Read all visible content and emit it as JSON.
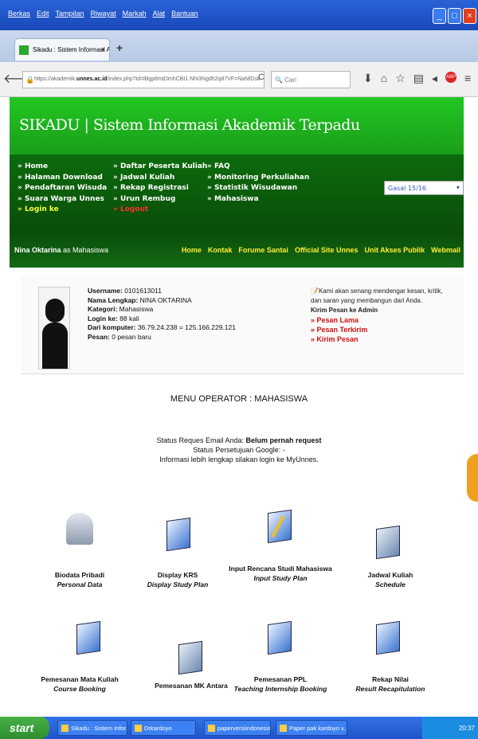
{
  "window": {
    "menu": [
      "Berkas",
      "Edit",
      "Tampilan",
      "Riwayat",
      "Markah",
      "Alat",
      "Bantuan"
    ]
  },
  "tab": {
    "title": "Sikadu : Sistem Informasi Aka...",
    "close": "×",
    "new": "+"
  },
  "address": {
    "url_prefix": "https://akademik.",
    "url_domain": "unnes.ac.id",
    "url_rest": "/index.php?id=lBgp8mtDmhCBt1.NhI3Ngdh2q87VF=NaNfGsk",
    "search_placeholder": "Cari"
  },
  "site": {
    "title": "SIKADU | Sistem Informasi Akademik Terpadu"
  },
  "nav": {
    "col1": [
      "» Home",
      "» Halaman Download",
      "» Pendaftaran Wisuda",
      "» Suara Warga Unnes",
      "» Login ke"
    ],
    "col2": [
      "» Daftar Peserta Kuliah",
      "» Jadwal Kuliah",
      "» Rekap Registrasi",
      "» Urun Rembug",
      "» Logout"
    ],
    "col3": [
      "» FAQ",
      "» Monitoring Perkuliahan",
      "» Statistik Wisudawan",
      "» Mahasiswa"
    ],
    "semester": "Gasal 15/16"
  },
  "userbar": {
    "name": "Nina Oktarina",
    "role": " as Mahasiswa",
    "links": [
      "Home",
      "Kontak",
      "Forume Santai",
      "Official Site Unnes",
      "Unit Akses Publik",
      "Webmail"
    ]
  },
  "profile": {
    "rows": [
      {
        "k": "Username:",
        "v": " 0101613011"
      },
      {
        "k": "Nama Lengkap:",
        "v": " NINA OKTARINA"
      },
      {
        "k": "Kategori:",
        "v": " Mahasiswa"
      },
      {
        "k": "Login ke:",
        "v": " 88 kali"
      },
      {
        "k": "Dari komputer:",
        "v": " 36.79.24.238 = 125.166.229.121"
      },
      {
        "k": "Pesan:",
        "v": " 0 pesan baru"
      }
    ],
    "message_intro": "Kami akan senang mendengar kesan, kritik, dan saran yang membangun dari Anda.",
    "message_head": "Kirim Pesan ke Admin",
    "message_links": [
      "» Pesan Lama",
      "» Pesan Terkirim",
      "» Kirim Pesan"
    ]
  },
  "menu_title": "MENU OPERATOR : MAHASISWA",
  "email_status": {
    "line1_a": "Status Reques Email Anda: ",
    "line1_b": "Belum pernah request",
    "line2": "Status Persetujuan Google: -",
    "line3": "Informasi lebih lengkap silakan login ke MyUnnes."
  },
  "menu_items": [
    {
      "title": "Biodata Pribadi",
      "sub": "Personal Data",
      "icon": "user-icon"
    },
    {
      "title": "Display KRS",
      "sub": "Display Study Plan",
      "icon": "book-icon"
    },
    {
      "title": "Input Rencana Studi Mahasiswa",
      "sub": "Input Study Plan",
      "icon": "book-pen-icon"
    },
    {
      "title": "Jadwal Kuliah",
      "sub": "Schedule",
      "icon": "schedule-icon"
    },
    {
      "title": "Pemesanan Mata Kuliah",
      "sub": "Course Booking",
      "icon": "book-icon"
    },
    {
      "title": "Pemesanan MK Antara",
      "sub": "",
      "icon": "schedule-icon"
    },
    {
      "title": "Pemesanan PPL",
      "sub": "Teaching Internship Booking",
      "icon": "book-icon"
    },
    {
      "title": "Rekap Nilai",
      "sub": "Result Recapitulation",
      "icon": "book-icon"
    }
  ],
  "taskbar": {
    "start": "start",
    "items": [
      "Sikadu : Sistem Infor...",
      "Drkardoyo",
      "paperversiindonesia...",
      "Paper pak kardoyo v..."
    ],
    "clock": "20:37"
  }
}
